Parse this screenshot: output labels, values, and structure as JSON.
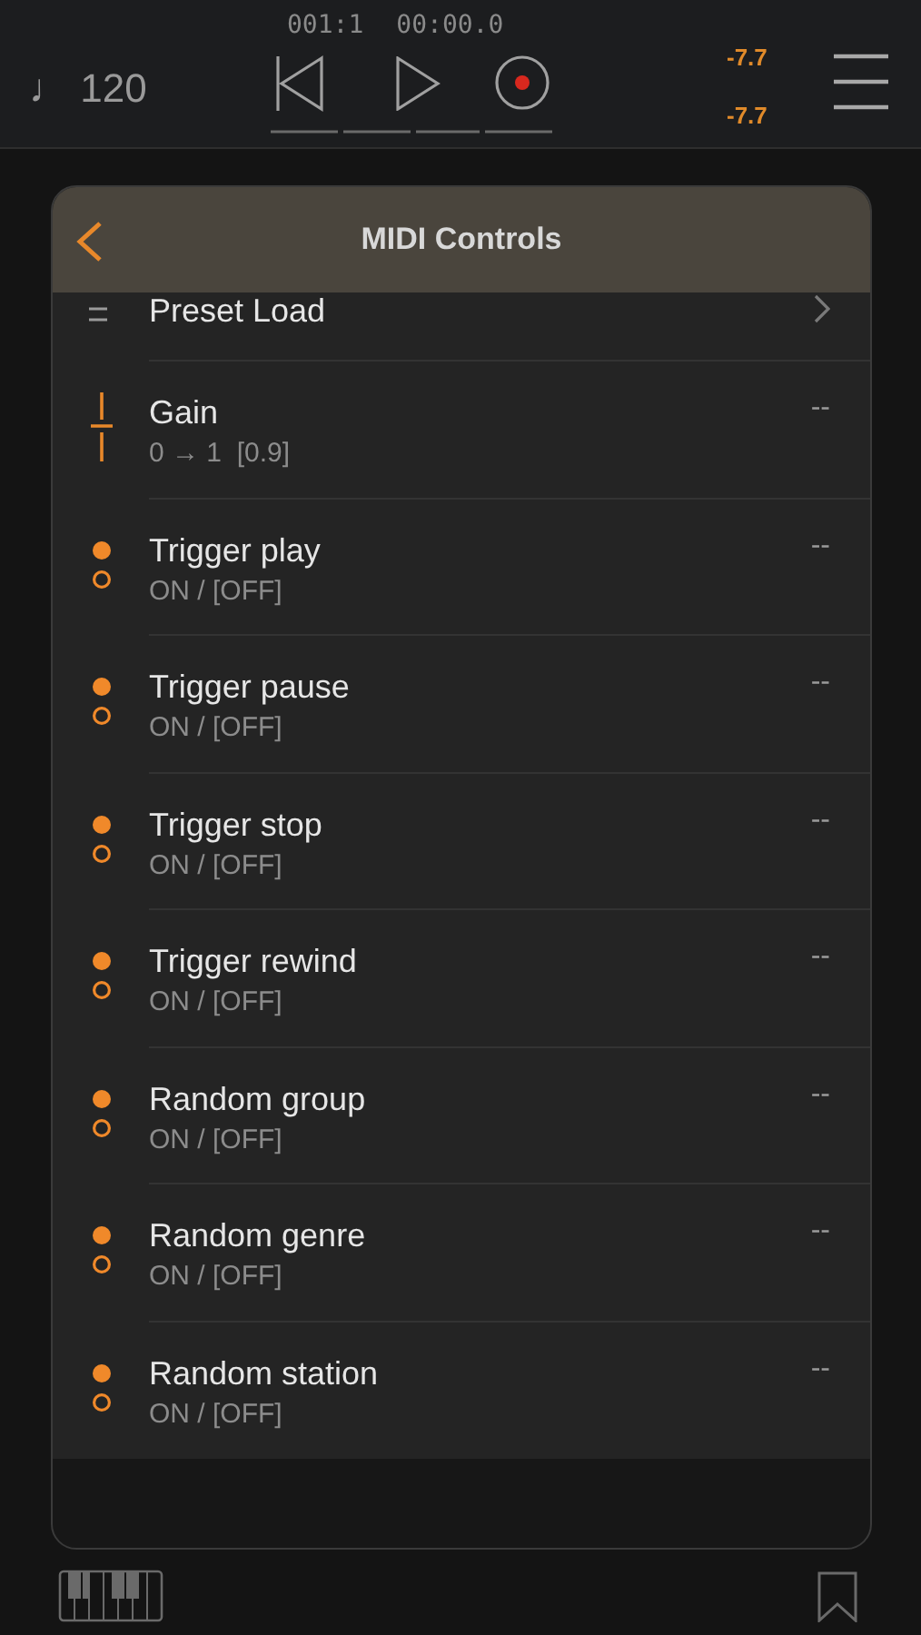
{
  "transport": {
    "tempo": "♩ 120",
    "position": "001:1",
    "time": "00:00.0",
    "levels": [
      "-7.7",
      "-7.7"
    ]
  },
  "panel": {
    "title": "MIDI Controls",
    "items": [
      {
        "kind": "menu",
        "label": "Preset Load"
      },
      {
        "kind": "slider",
        "label": "Gain",
        "detail": "0 → 1  [0.9]",
        "value": "--"
      },
      {
        "kind": "toggle",
        "label": "Trigger play",
        "detail": "ON / [OFF]",
        "value": "--"
      },
      {
        "kind": "toggle",
        "label": "Trigger pause",
        "detail": "ON / [OFF]",
        "value": "--"
      },
      {
        "kind": "toggle",
        "label": "Trigger stop",
        "detail": "ON / [OFF]",
        "value": "--"
      },
      {
        "kind": "toggle",
        "label": "Trigger rewind",
        "detail": "ON / [OFF]",
        "value": "--"
      },
      {
        "kind": "toggle",
        "label": "Random group",
        "detail": "ON / [OFF]",
        "value": "--"
      },
      {
        "kind": "toggle",
        "label": "Random genre",
        "detail": "ON / [OFF]",
        "value": "--"
      },
      {
        "kind": "toggle",
        "label": "Random station",
        "detail": "ON / [OFF]",
        "value": "--"
      }
    ]
  }
}
